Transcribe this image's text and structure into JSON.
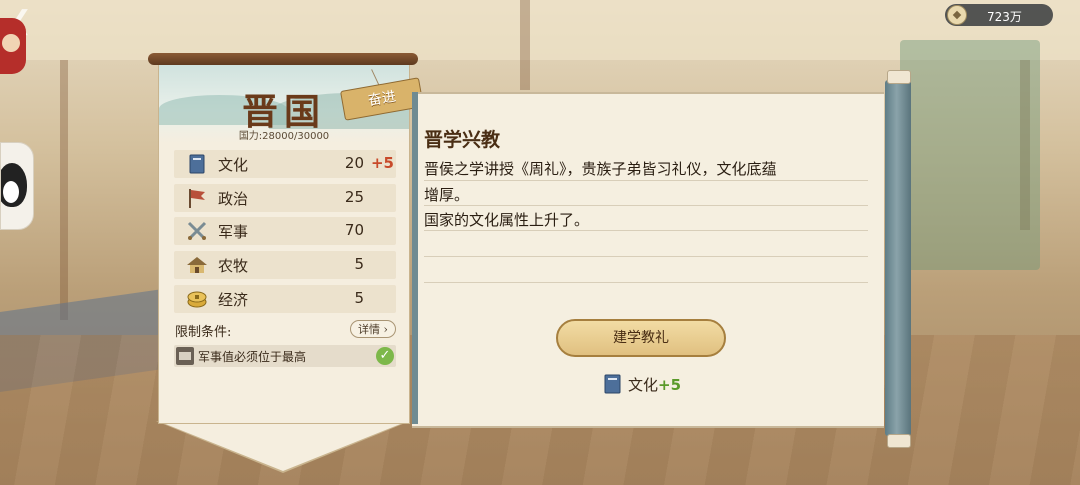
{
  "currency": {
    "icon": "coin-icon",
    "amount": "723万"
  },
  "state": {
    "name": "晋国",
    "power_label": "国力:28000/30000",
    "tag": "奋进"
  },
  "stats": [
    {
      "icon": "book-icon",
      "label": "文化",
      "value": "20",
      "bonus": "+5"
    },
    {
      "icon": "flag-icon",
      "label": "政治",
      "value": "25",
      "bonus": ""
    },
    {
      "icon": "crossed-swords-icon",
      "label": "军事",
      "value": "70",
      "bonus": ""
    },
    {
      "icon": "farmhouse-icon",
      "label": "农牧",
      "value": "5",
      "bonus": ""
    },
    {
      "icon": "coins-icon",
      "label": "经济",
      "value": "5",
      "bonus": ""
    }
  ],
  "conditions": {
    "title": "限制条件:",
    "detail_label": "详情",
    "items": [
      {
        "text": "军事值必须位于最高",
        "met": true
      }
    ]
  },
  "event": {
    "title": "晋学兴教",
    "lines": [
      "晋侯之学讲授《周礼》，贵族子弟皆习礼仪，文化底蕴",
      "增厚。",
      "国家的文化属性上升了。"
    ],
    "action_label": "建学教礼",
    "reward_label": "文化",
    "reward_value": "+5"
  },
  "colors": {
    "accent": "#c84a2a",
    "positive": "#5a9a2a",
    "brown": "#6a3a1a"
  }
}
